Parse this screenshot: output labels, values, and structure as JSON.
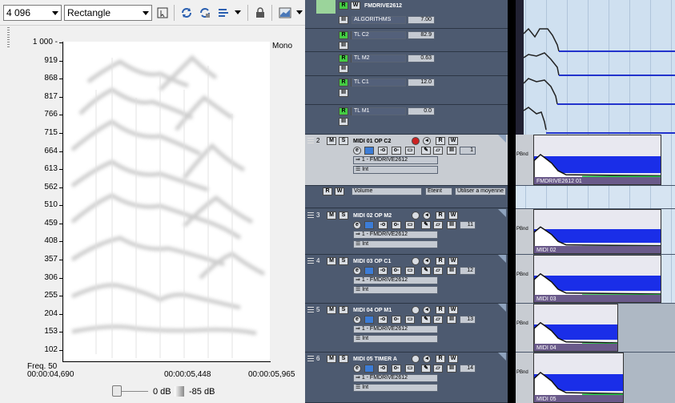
{
  "analyzer": {
    "fft_size": "4 096",
    "window_type": "Rectangle",
    "channel": "Mono",
    "y_ticks": [
      "1 000 -",
      "919",
      "868",
      "817",
      "766",
      "715",
      "664",
      "613",
      "562",
      "510",
      "459",
      "408",
      "357",
      "306",
      "255",
      "204",
      "153",
      "102"
    ],
    "freq_label": "Freq. 50",
    "x_ticks": [
      "00:00:04,690",
      "00:00:05,448",
      "00:00:05,965"
    ],
    "db_min_label": "0 dB",
    "db_max_label": "-85 dB"
  },
  "daw": {
    "folder_track": {
      "name": "FMDRIVE2612"
    },
    "automation": [
      {
        "param": "ALGORITHMS",
        "value": "7.00"
      },
      {
        "param": "TL C2",
        "value": "82.9"
      },
      {
        "param": "TL M2",
        "value": "0.63"
      },
      {
        "param": "TL C1",
        "value": "12.0"
      },
      {
        "param": "TL M1",
        "value": "0.0"
      }
    ],
    "tracks": [
      {
        "num": "2",
        "name": "MIDI 01 OP C2",
        "channel": "1",
        "output": "1 - FMDRIVE2612",
        "input": "Int",
        "clip": "FMDRIVE2612 01",
        "sel": true
      },
      {
        "num": "3",
        "name": "MIDI 02 OP M2",
        "channel": "11",
        "output": "1 - FMDRIVE2612",
        "input": "Int",
        "clip": "MIDI 02"
      },
      {
        "num": "4",
        "name": "MIDI 03 OP C1",
        "channel": "12",
        "output": "1 - FMDRIVE2612",
        "input": "Int",
        "clip": "MIDI 03"
      },
      {
        "num": "5",
        "name": "MIDI 04 OP M1",
        "channel": "13",
        "output": "1 - FMDRIVE2612",
        "input": "Int",
        "clip": "MIDI 04"
      },
      {
        "num": "6",
        "name": "MIDI 05 TIMER A",
        "channel": "14",
        "output": "1 - FMDRIVE2612",
        "input": "Int",
        "clip": "MIDI 05"
      }
    ],
    "volume_lane": {
      "param": "Volume",
      "state": "Eteint",
      "mode": "Utiliser   a moyenne"
    },
    "lane_side_label": "PBnd",
    "btn_r": "R",
    "btn_w": "W",
    "btn_m": "M",
    "btn_s": "S"
  }
}
